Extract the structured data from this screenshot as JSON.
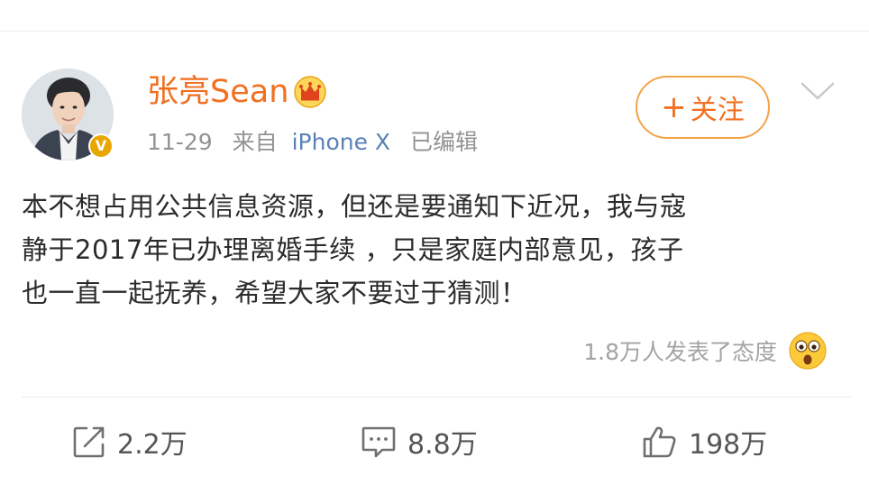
{
  "post": {
    "author": {
      "name": "张亮Sean",
      "verified": true,
      "badge_color": "#e8a600",
      "name_color": "#f26f20",
      "vip_icon": "crown-icon"
    },
    "meta": {
      "date": "11-29",
      "source_prefix": "来自",
      "source": "iPhone X",
      "edited": "已编辑"
    },
    "follow_button": {
      "plus": "+",
      "label": "关注"
    },
    "menu_icon": "chevron-down-icon",
    "body_lines": [
      "本不想占用公共信息资源，但还是要通知下近况，我与寇",
      "静于2017年已办理离婚手续 ，只是家庭内部意见，孩子",
      "也一直一起抚养，希望大家不要过于猜测！"
    ],
    "reactions": {
      "text": "1.8万人发表了态度",
      "emoji_icon": "surprised-emoji-icon"
    },
    "actions": {
      "repost": {
        "icon": "share-icon",
        "count": "2.2万"
      },
      "comment": {
        "icon": "comment-icon",
        "count": "8.8万"
      },
      "like": {
        "icon": "thumbs-up-icon",
        "count": "198万"
      }
    }
  }
}
